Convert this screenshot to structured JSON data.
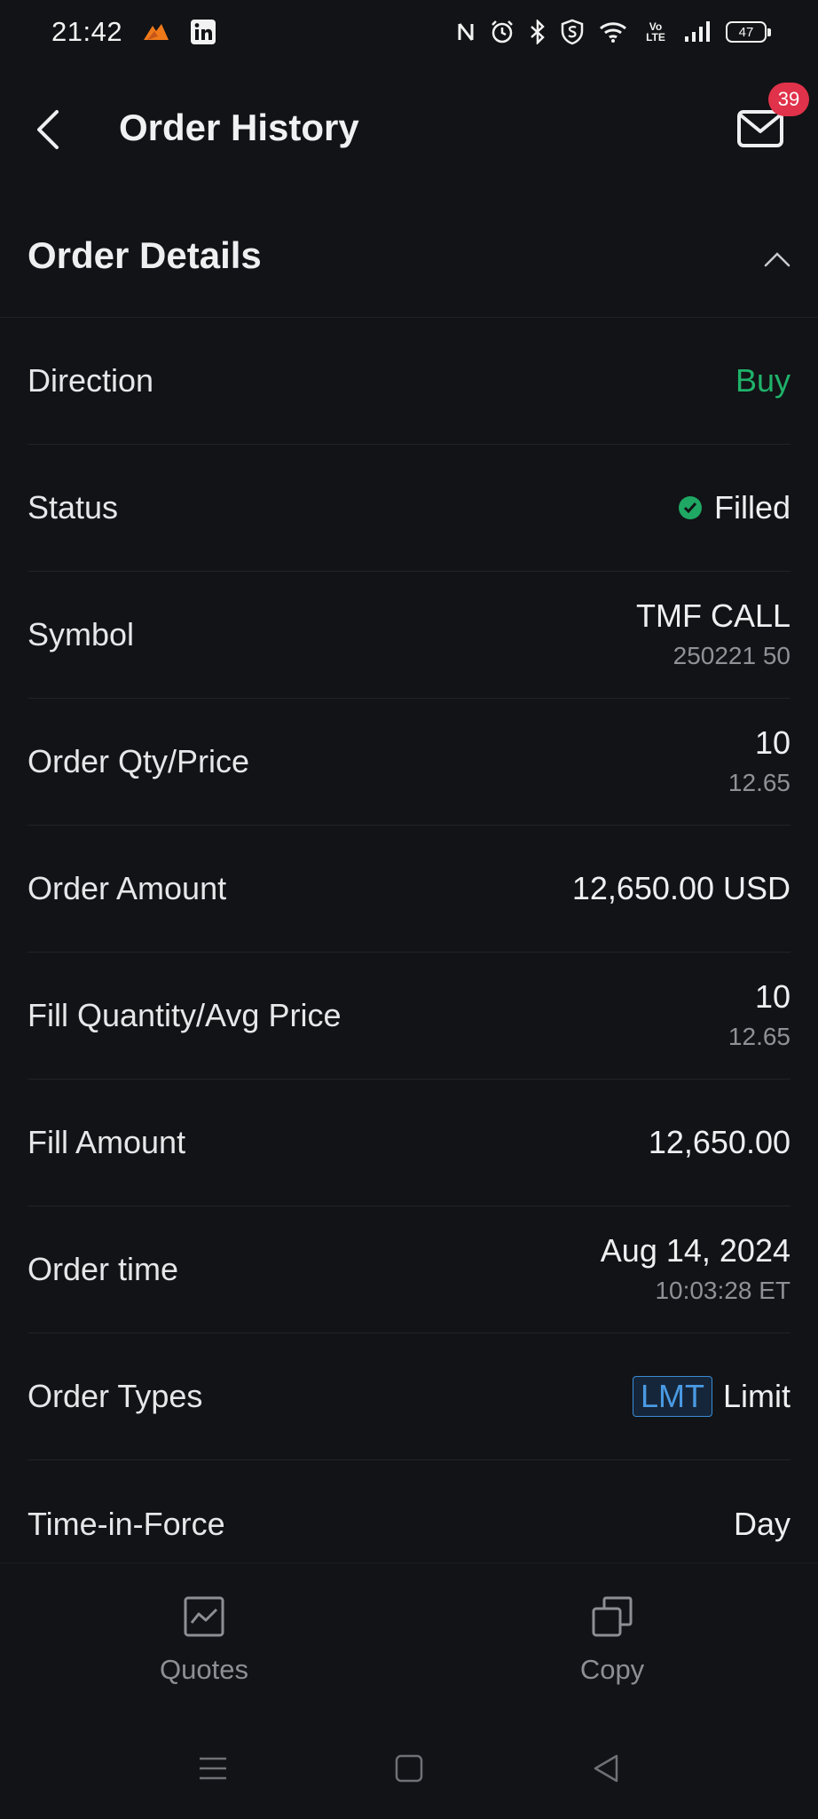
{
  "status_bar": {
    "time": "21:42",
    "battery": "47",
    "icons": [
      "app-notification-icon",
      "linkedin-icon",
      "nfc-icon",
      "alarm-icon",
      "bluetooth-icon",
      "shield-s-icon",
      "wifi-icon",
      "volte-icon",
      "signal-icon",
      "battery-icon"
    ],
    "volte_text": "Vo LTE"
  },
  "header": {
    "title": "Order History",
    "mail_badge": "39"
  },
  "section": {
    "title": "Order Details"
  },
  "rows": [
    {
      "label": "Direction",
      "value": "Buy",
      "value_color": "#1fb26a"
    },
    {
      "label": "Status",
      "value": "Filled",
      "status_color": "#1fa863"
    },
    {
      "label": "Symbol",
      "value": "TMF CALL",
      "sub": "250221 50"
    },
    {
      "label": "Order Qty/Price",
      "value": "10",
      "sub": "12.65"
    },
    {
      "label": "Order Amount",
      "value": "12,650.00 USD"
    },
    {
      "label": "Fill Quantity/Avg Price",
      "value": "10",
      "sub": "12.65"
    },
    {
      "label": "Fill Amount",
      "value": "12,650.00"
    },
    {
      "label": "Order time",
      "value": "Aug 14, 2024",
      "sub": "10:03:28 ET"
    },
    {
      "label": "Order Types",
      "badge": "LMT",
      "value": "Limit"
    },
    {
      "label": "Time-in-Force",
      "value": "Day"
    }
  ],
  "bottom_tabs": [
    {
      "label": "Quotes",
      "icon": "quotes-chart-icon"
    },
    {
      "label": "Copy",
      "icon": "copy-icon"
    }
  ],
  "colors": {
    "background": "#121316",
    "accent_green": "#1fb26a",
    "badge_red": "#e0324a",
    "lmt_blue": "#4a9ae4"
  }
}
